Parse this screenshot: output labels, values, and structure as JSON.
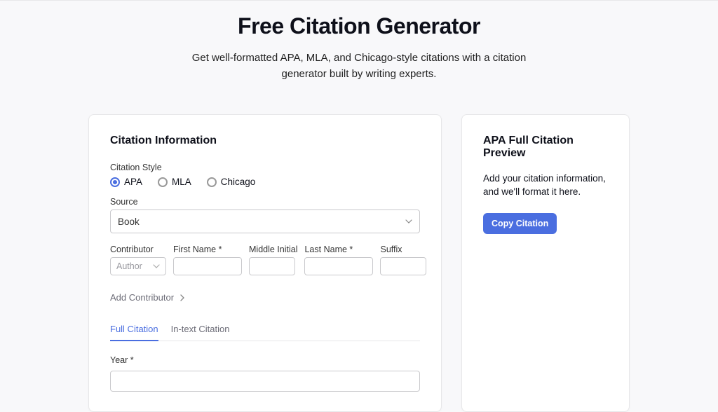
{
  "hero": {
    "title": "Free Citation Generator",
    "subtitle": "Get well-formatted APA, MLA, and Chicago-style citations with a citation generator built by writing experts."
  },
  "form": {
    "heading": "Citation Information",
    "style_label": "Citation Style",
    "styles": {
      "apa": "APA",
      "mla": "MLA",
      "chicago": "Chicago"
    },
    "source_label": "Source",
    "source_value": "Book",
    "contrib": {
      "label": "Contributor",
      "author_placeholder": "Author",
      "first_label": "First Name *",
      "middle_label": "Middle Initial",
      "last_label": "Last Name *",
      "suffix_label": "Suffix",
      "add_label": "Add Contributor"
    },
    "tabs": {
      "full": "Full Citation",
      "intext": "In-text Citation"
    },
    "year_label": "Year *"
  },
  "preview": {
    "heading": "APA Full Citation Preview",
    "message": "Add your citation information, and we'll format it here.",
    "copy_label": "Copy Citation"
  }
}
